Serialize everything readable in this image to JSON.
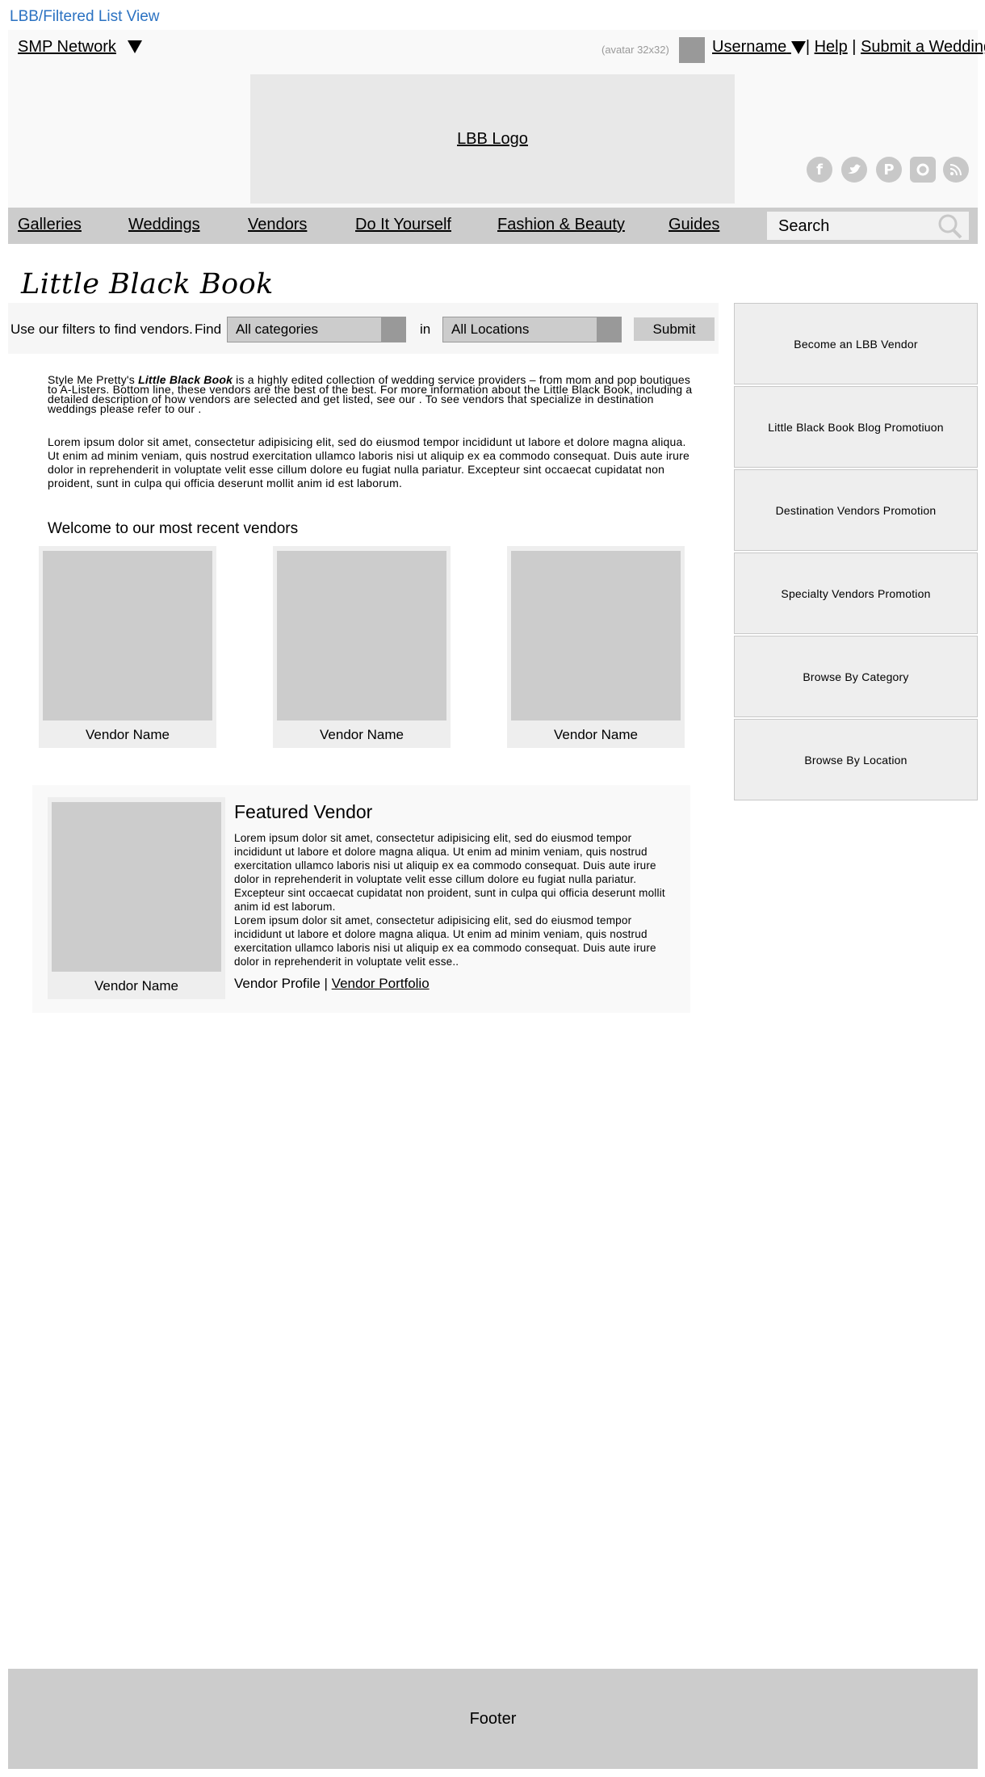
{
  "page_label": "LBB/Filtered List View",
  "header": {
    "network_label": "SMP Network",
    "avatar_hint": "(avatar 32x32)",
    "username": "Username",
    "separator": "|",
    "help": "Help",
    "submit_wedding": "Submit a Wedding",
    "logo_text": "LBB Logo",
    "social_icons": [
      "facebook-icon",
      "twitter-icon",
      "pinterest-icon",
      "instagram-icon",
      "rss-icon"
    ]
  },
  "nav": {
    "items": [
      "Galleries",
      "Weddings",
      "Vendors",
      "Do It Yourself",
      "Fashion & Beauty",
      "Guides"
    ],
    "search_label": "Search"
  },
  "title": "Little Black Book",
  "filters": {
    "intro": "Use our filters to find vendors.",
    "find": "Find",
    "category": "All categories",
    "in": "in",
    "location": "All Locations",
    "submit": "Submit"
  },
  "intro": {
    "prefix": "Style Me Pretty's ",
    "bold": "Little Black Book",
    "rest": " is a highly edited collection of wedding service providers – from mom and pop boutiques to A-Listers. Bottom line, these vendors are the best of the best.  For more information about the Little Black Book, including a detailed description of how vendors are selected and get listed, see our . To see vendors that specialize in destination weddings please refer to our ."
  },
  "lorem": "Lorem ipsum dolor sit amet, consectetur adipisicing elit, sed do eiusmod tempor incididunt ut labore et dolore magna aliqua. Ut enim ad minim veniam, quis nostrud exercitation ullamco laboris nisi ut aliquip ex ea commodo consequat. Duis aute irure dolor in reprehenderit in voluptate velit esse cillum dolore eu fugiat nulla pariatur. Excepteur sint occaecat cupidatat non proident, sunt in culpa qui officia deserunt mollit anim id est laborum.",
  "recent": {
    "title": "Welcome to our most recent vendors",
    "vendors": [
      "Vendor Name",
      "Vendor Name",
      "Vendor Name"
    ]
  },
  "featured": {
    "vendor_name": "Vendor Name",
    "title": "Featured Vendor",
    "p1": "Lorem ipsum dolor sit amet, consectetur adipisicing elit, sed do eiusmod tempor incididunt ut labore et dolore magna aliqua. Ut enim ad minim veniam, quis nostrud exercitation ullamco laboris nisi ut aliquip ex ea commodo consequat. Duis aute irure dolor in reprehenderit in voluptate velit esse cillum dolore eu fugiat nulla pariatur. Excepteur sint occaecat cupidatat non proident, sunt in culpa qui officia deserunt mollit anim id est laborum.",
    "p2": "Lorem ipsum dolor sit amet, consectetur adipisicing elit, sed do eiusmod tempor incididunt ut labore et dolore magna aliqua. Ut enim ad minim veniam, quis nostrud exercitation ullamco laboris nisi ut aliquip ex ea commodo consequat. Duis aute irure dolor in reprehenderit in voluptate velit esse..",
    "profile": "Vendor Profile",
    "separator": "|",
    "portfolio": "Vendor Portfolio"
  },
  "sidebar": {
    "items": [
      "Become an LBB Vendor",
      "Little Black Book Blog Promotiuon",
      "Destination Vendors Promotion",
      "Specialty Vendors Promotion",
      "Browse By Category",
      "Browse By Location"
    ]
  },
  "footer": "Footer"
}
